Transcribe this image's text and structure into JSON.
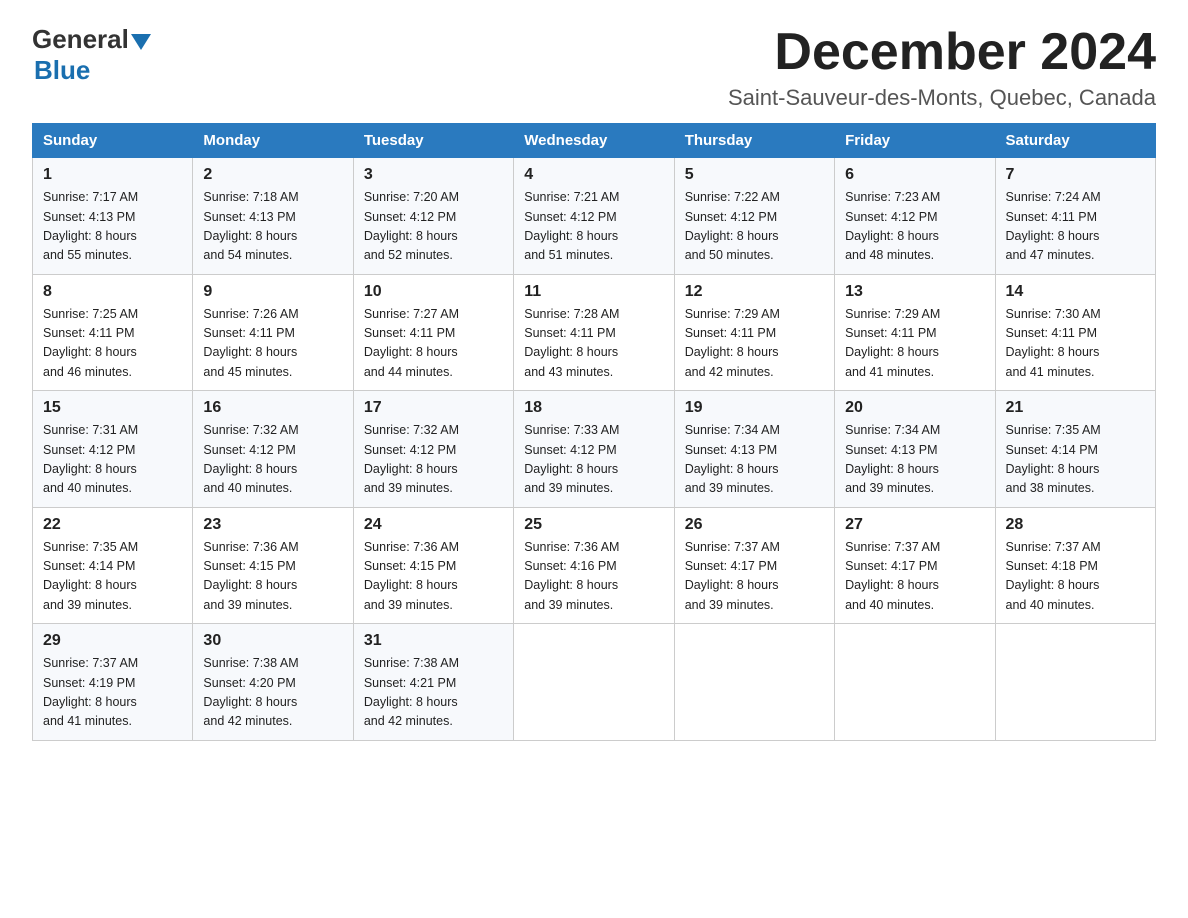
{
  "logo": {
    "general": "General",
    "triangle": "▲",
    "blue": "Blue"
  },
  "header": {
    "month_year": "December 2024",
    "location": "Saint-Sauveur-des-Monts, Quebec, Canada"
  },
  "weekdays": [
    "Sunday",
    "Monday",
    "Tuesday",
    "Wednesday",
    "Thursday",
    "Friday",
    "Saturday"
  ],
  "weeks": [
    [
      {
        "day": "1",
        "sunrise": "7:17 AM",
        "sunset": "4:13 PM",
        "daylight": "8 hours and 55 minutes."
      },
      {
        "day": "2",
        "sunrise": "7:18 AM",
        "sunset": "4:13 PM",
        "daylight": "8 hours and 54 minutes."
      },
      {
        "day": "3",
        "sunrise": "7:20 AM",
        "sunset": "4:12 PM",
        "daylight": "8 hours and 52 minutes."
      },
      {
        "day": "4",
        "sunrise": "7:21 AM",
        "sunset": "4:12 PM",
        "daylight": "8 hours and 51 minutes."
      },
      {
        "day": "5",
        "sunrise": "7:22 AM",
        "sunset": "4:12 PM",
        "daylight": "8 hours and 50 minutes."
      },
      {
        "day": "6",
        "sunrise": "7:23 AM",
        "sunset": "4:12 PM",
        "daylight": "8 hours and 48 minutes."
      },
      {
        "day": "7",
        "sunrise": "7:24 AM",
        "sunset": "4:11 PM",
        "daylight": "8 hours and 47 minutes."
      }
    ],
    [
      {
        "day": "8",
        "sunrise": "7:25 AM",
        "sunset": "4:11 PM",
        "daylight": "8 hours and 46 minutes."
      },
      {
        "day": "9",
        "sunrise": "7:26 AM",
        "sunset": "4:11 PM",
        "daylight": "8 hours and 45 minutes."
      },
      {
        "day": "10",
        "sunrise": "7:27 AM",
        "sunset": "4:11 PM",
        "daylight": "8 hours and 44 minutes."
      },
      {
        "day": "11",
        "sunrise": "7:28 AM",
        "sunset": "4:11 PM",
        "daylight": "8 hours and 43 minutes."
      },
      {
        "day": "12",
        "sunrise": "7:29 AM",
        "sunset": "4:11 PM",
        "daylight": "8 hours and 42 minutes."
      },
      {
        "day": "13",
        "sunrise": "7:29 AM",
        "sunset": "4:11 PM",
        "daylight": "8 hours and 41 minutes."
      },
      {
        "day": "14",
        "sunrise": "7:30 AM",
        "sunset": "4:11 PM",
        "daylight": "8 hours and 41 minutes."
      }
    ],
    [
      {
        "day": "15",
        "sunrise": "7:31 AM",
        "sunset": "4:12 PM",
        "daylight": "8 hours and 40 minutes."
      },
      {
        "day": "16",
        "sunrise": "7:32 AM",
        "sunset": "4:12 PM",
        "daylight": "8 hours and 40 minutes."
      },
      {
        "day": "17",
        "sunrise": "7:32 AM",
        "sunset": "4:12 PM",
        "daylight": "8 hours and 39 minutes."
      },
      {
        "day": "18",
        "sunrise": "7:33 AM",
        "sunset": "4:12 PM",
        "daylight": "8 hours and 39 minutes."
      },
      {
        "day": "19",
        "sunrise": "7:34 AM",
        "sunset": "4:13 PM",
        "daylight": "8 hours and 39 minutes."
      },
      {
        "day": "20",
        "sunrise": "7:34 AM",
        "sunset": "4:13 PM",
        "daylight": "8 hours and 39 minutes."
      },
      {
        "day": "21",
        "sunrise": "7:35 AM",
        "sunset": "4:14 PM",
        "daylight": "8 hours and 38 minutes."
      }
    ],
    [
      {
        "day": "22",
        "sunrise": "7:35 AM",
        "sunset": "4:14 PM",
        "daylight": "8 hours and 39 minutes."
      },
      {
        "day": "23",
        "sunrise": "7:36 AM",
        "sunset": "4:15 PM",
        "daylight": "8 hours and 39 minutes."
      },
      {
        "day": "24",
        "sunrise": "7:36 AM",
        "sunset": "4:15 PM",
        "daylight": "8 hours and 39 minutes."
      },
      {
        "day": "25",
        "sunrise": "7:36 AM",
        "sunset": "4:16 PM",
        "daylight": "8 hours and 39 minutes."
      },
      {
        "day": "26",
        "sunrise": "7:37 AM",
        "sunset": "4:17 PM",
        "daylight": "8 hours and 39 minutes."
      },
      {
        "day": "27",
        "sunrise": "7:37 AM",
        "sunset": "4:17 PM",
        "daylight": "8 hours and 40 minutes."
      },
      {
        "day": "28",
        "sunrise": "7:37 AM",
        "sunset": "4:18 PM",
        "daylight": "8 hours and 40 minutes."
      }
    ],
    [
      {
        "day": "29",
        "sunrise": "7:37 AM",
        "sunset": "4:19 PM",
        "daylight": "8 hours and 41 minutes."
      },
      {
        "day": "30",
        "sunrise": "7:38 AM",
        "sunset": "4:20 PM",
        "daylight": "8 hours and 42 minutes."
      },
      {
        "day": "31",
        "sunrise": "7:38 AM",
        "sunset": "4:21 PM",
        "daylight": "8 hours and 42 minutes."
      },
      null,
      null,
      null,
      null
    ]
  ],
  "labels": {
    "sunrise": "Sunrise:",
    "sunset": "Sunset:",
    "daylight": "Daylight:"
  }
}
